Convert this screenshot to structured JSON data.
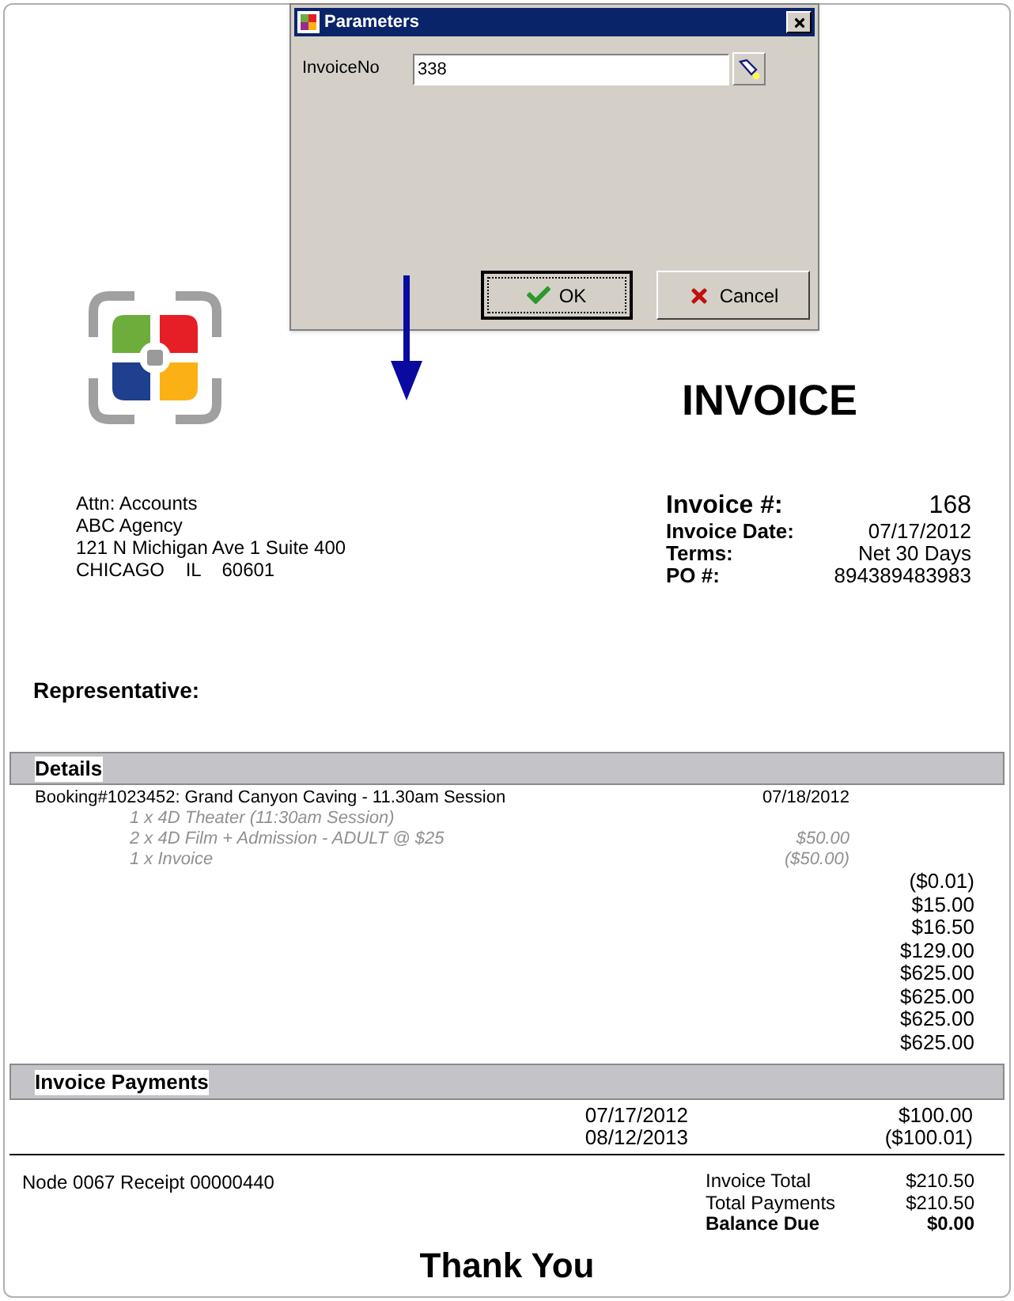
{
  "dialog": {
    "title": "Parameters",
    "field_label": "InvoiceNo",
    "field_value": "338",
    "ok": "OK",
    "cancel": "Cancel"
  },
  "invoice": {
    "title": "INVOICE",
    "address": [
      "Attn: Accounts",
      "ABC Agency",
      "121 N Michigan Ave 1 Suite 400",
      "CHICAGO    IL    60601"
    ],
    "info": [
      {
        "label": "Invoice #:",
        "value": "168",
        "kind": "large"
      },
      {
        "label": "Invoice Date:",
        "value": "07/17/2012",
        "kind": "normal"
      },
      {
        "label": "Terms:",
        "value": "Net 30 Days",
        "kind": "normal"
      },
      {
        "label": "PO #:",
        "value": "894389483983",
        "kind": "normal"
      }
    ],
    "representative": "Representative:",
    "details": {
      "heading": "Details",
      "booking": {
        "text": "Booking#1023452: Grand Canyon Caving - 11.30am Session",
        "date": "07/18/2012"
      },
      "items": [
        {
          "text": "1 x 4D Theater (11:30am Session)"
        },
        {
          "text": "2 x 4D Film + Admission - ADULT @ $25",
          "amount": "$50.00"
        },
        {
          "text": "1 x Invoice",
          "amount": "($50.00)"
        }
      ],
      "amounts": [
        "($0.01)",
        "$15.00",
        "$16.50",
        "$129.00",
        "$625.00",
        "$625.00",
        "$625.00",
        "$625.00"
      ]
    },
    "payments": {
      "heading": "Invoice Payments",
      "rows": [
        {
          "date": "07/17/2012",
          "amount": "$100.00"
        },
        {
          "date": "08/12/2013",
          "amount": "($100.01)"
        }
      ]
    },
    "receipt": "Node 0067 Receipt 00000440",
    "totals": [
      {
        "label": "Invoice Total",
        "value": "$210.50",
        "kind": "normal"
      },
      {
        "label": "Total Payments",
        "value": "$210.50",
        "kind": "normal"
      },
      {
        "label": "Balance Due",
        "value": "$0.00",
        "kind": "bold"
      }
    ],
    "footer": "Thank You"
  }
}
